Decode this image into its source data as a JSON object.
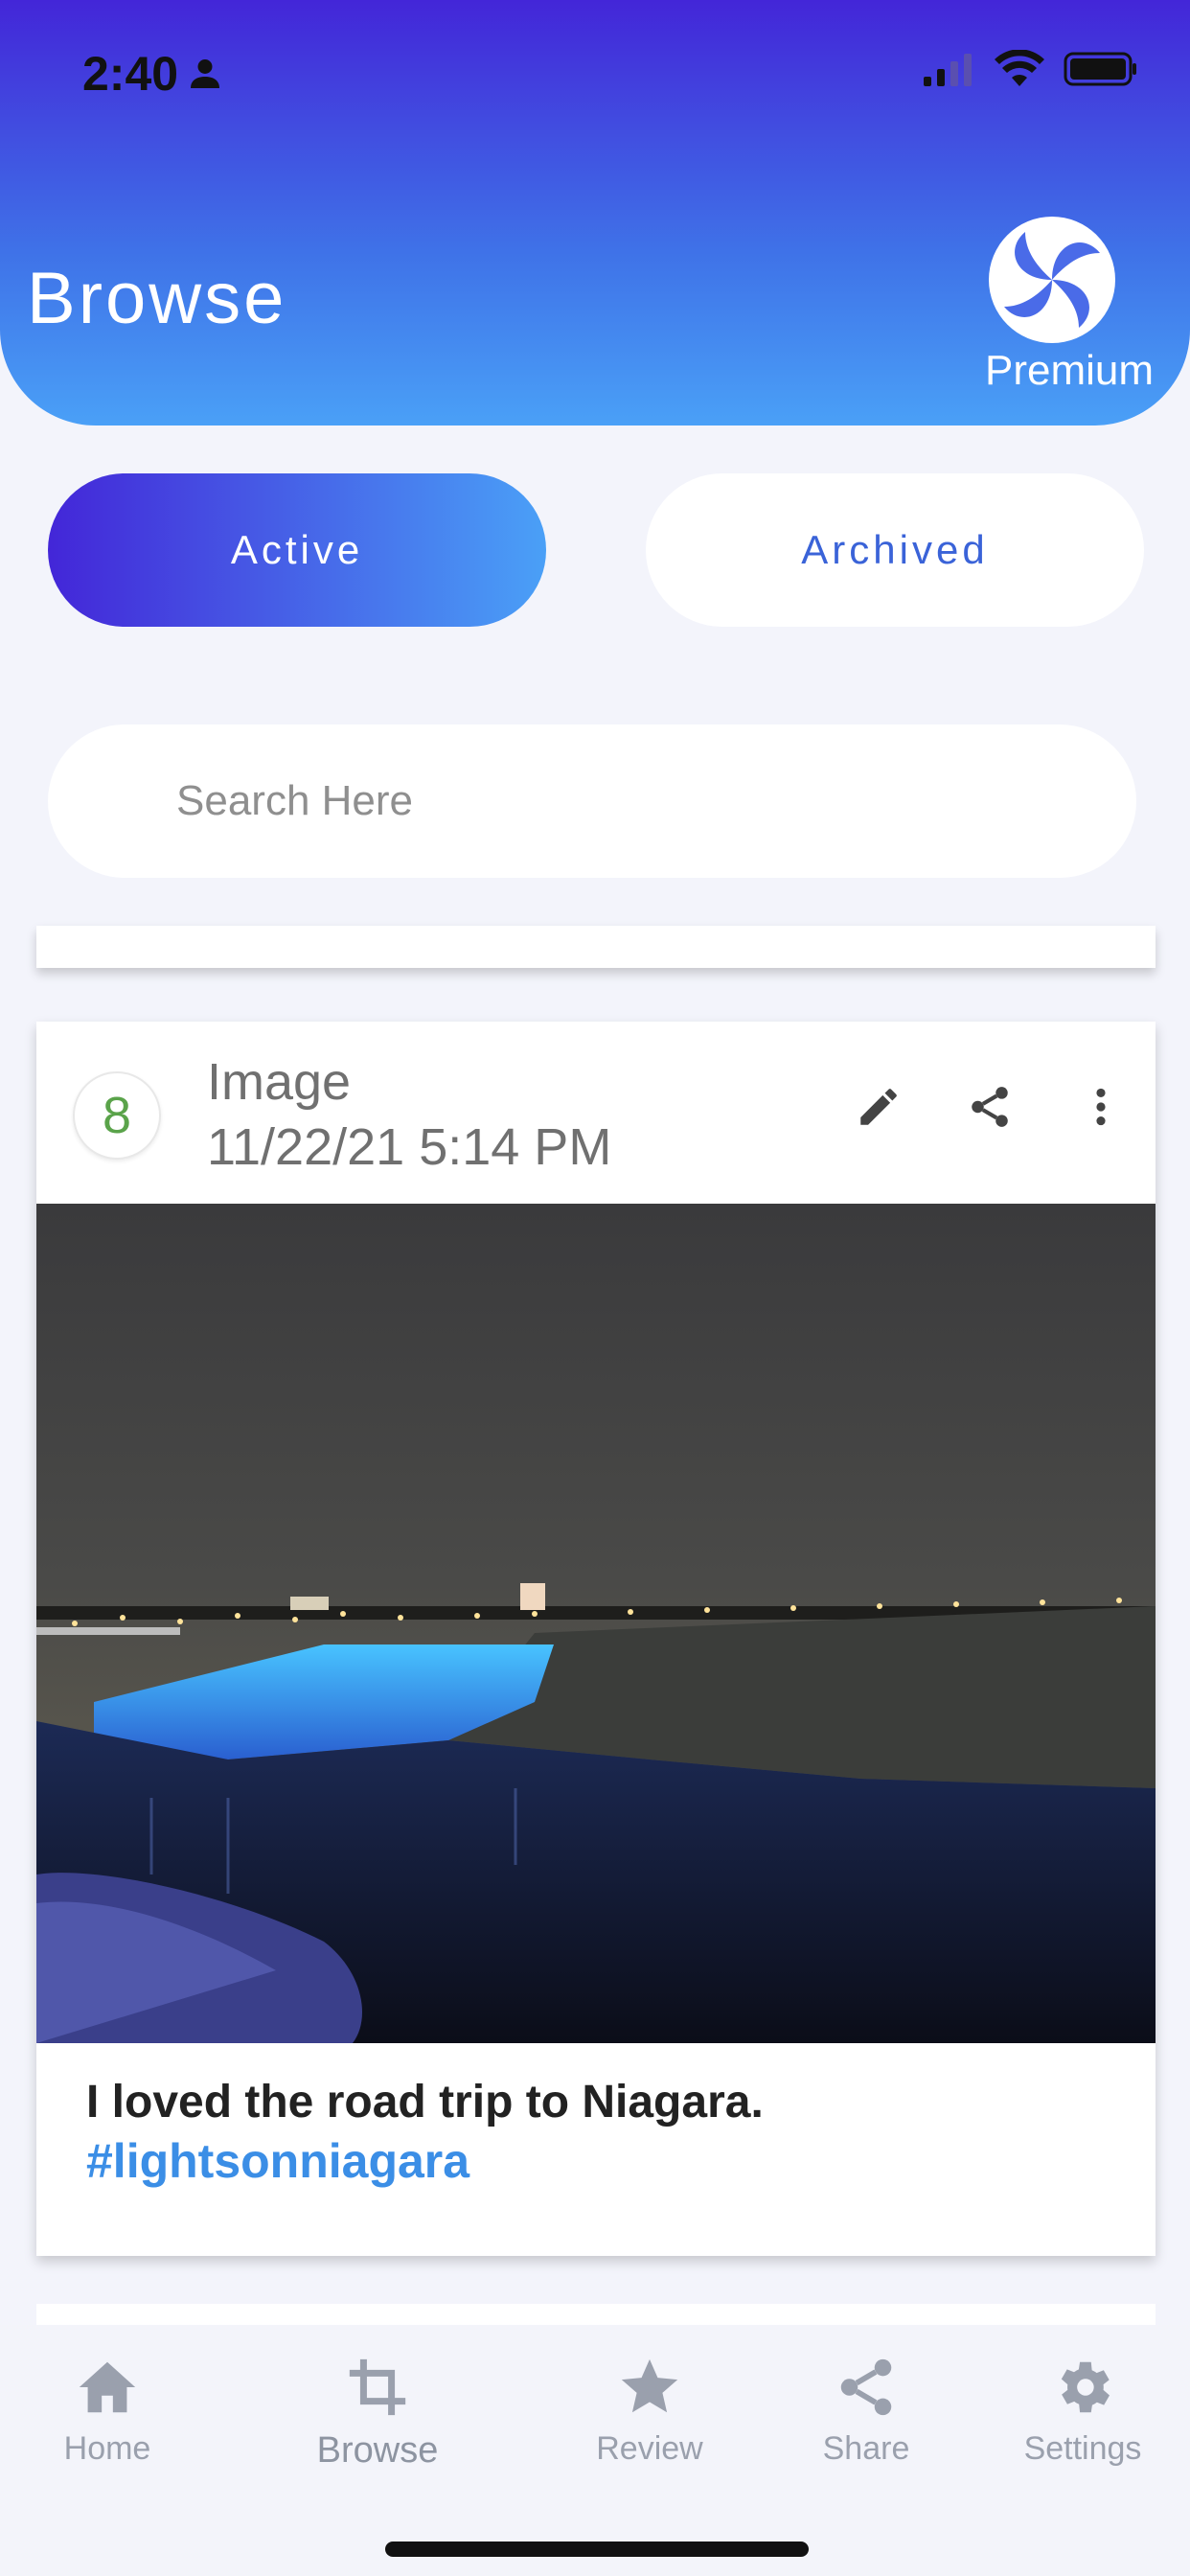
{
  "status_bar": {
    "time": "2:40"
  },
  "header": {
    "title": "Browse",
    "badge_label": "Premium"
  },
  "tabs": [
    {
      "label": "Active",
      "selected": true
    },
    {
      "label": "Archived",
      "selected": false
    }
  ],
  "search": {
    "placeholder": "Search Here"
  },
  "card": {
    "number": "8",
    "type": "Image",
    "datetime": "11/22/21 5:14 PM",
    "caption": "I loved the road trip to Niagara.",
    "hashtag": "#lightsonniagara",
    "actions": [
      "pencil-icon",
      "share-icon",
      "more-vert-icon"
    ]
  },
  "bottom_nav": [
    {
      "label": "Home",
      "icon": "home-icon"
    },
    {
      "label": "Browse",
      "icon": "crop-icon",
      "active": true
    },
    {
      "label": "Review",
      "icon": "star-icon"
    },
    {
      "label": "Share",
      "icon": "share-icon"
    },
    {
      "label": "Settings",
      "icon": "gear-icon"
    }
  ],
  "colors": {
    "header_gradient_start": "#4326d8",
    "header_gradient_end": "#4aa0f7",
    "hashtag": "#3b8ee6",
    "badge_number": "#5aa34a"
  }
}
